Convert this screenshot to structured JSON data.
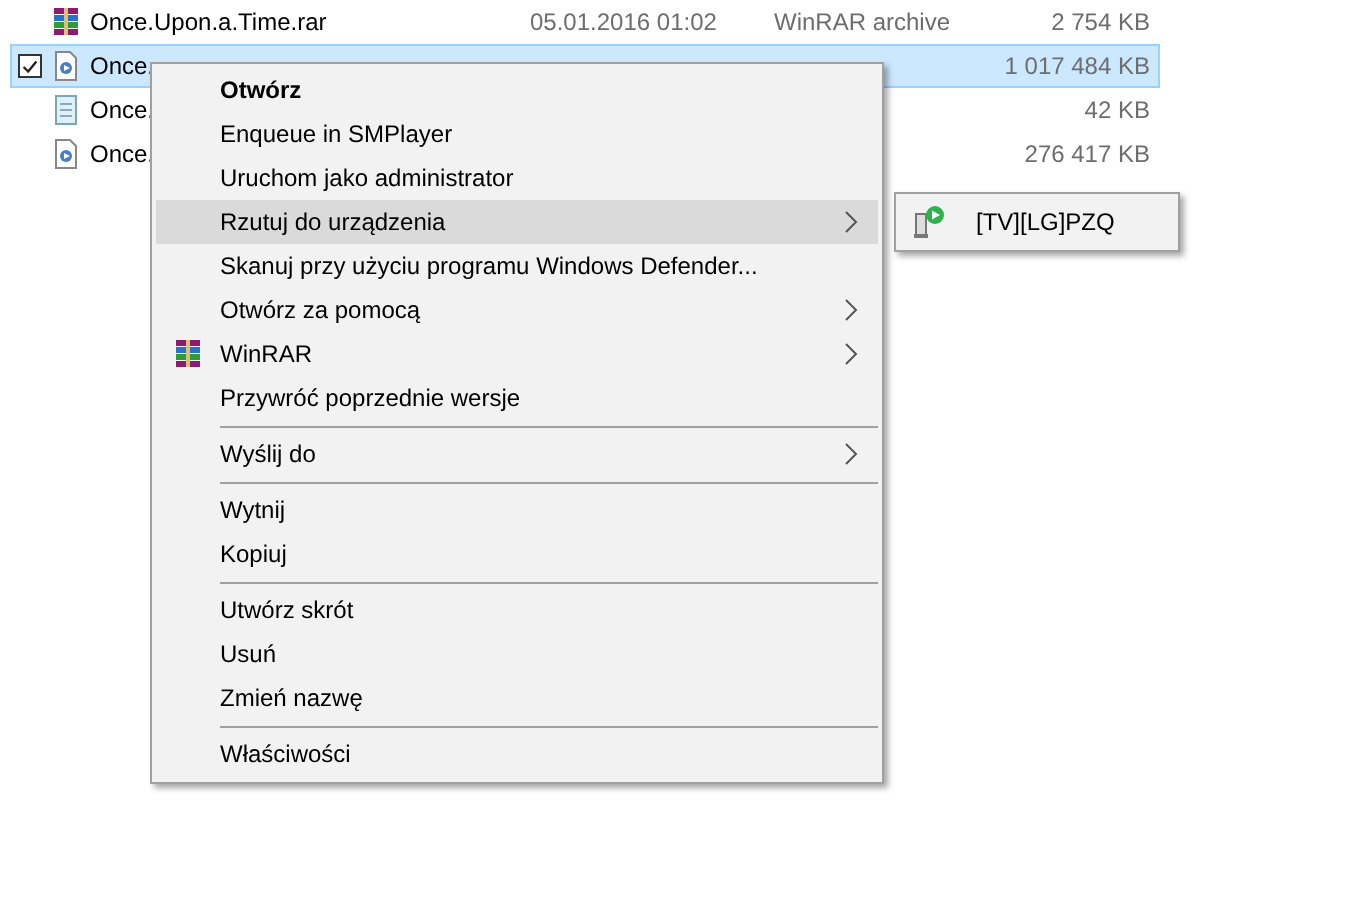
{
  "files": [
    {
      "kind": "archive",
      "checked": false,
      "selected": false,
      "name": "Once.Upon.a.Time.rar",
      "date": "05.01.2016 01:02",
      "type": "WinRAR archive",
      "size": "2 754 KB"
    },
    {
      "kind": "video",
      "checked": true,
      "selected": true,
      "name": "Once.",
      "size": "1 017 484 KB"
    },
    {
      "kind": "text",
      "checked": false,
      "selected": false,
      "name": "Once.",
      "size": "42 KB"
    },
    {
      "kind": "video",
      "checked": false,
      "selected": false,
      "name": "Once.",
      "size": "276 417 KB"
    }
  ],
  "context_menu": {
    "items": [
      {
        "kind": "item",
        "label": "Otwórz",
        "bold": true,
        "selected": false,
        "submenu": false
      },
      {
        "kind": "item",
        "label": "Enqueue in SMPlayer",
        "bold": false,
        "selected": false,
        "submenu": false
      },
      {
        "kind": "item",
        "label": "Uruchom jako administrator",
        "bold": false,
        "selected": false,
        "submenu": false
      },
      {
        "kind": "item",
        "label": "Rzutuj do urządzenia",
        "bold": false,
        "selected": true,
        "submenu": true
      },
      {
        "kind": "item",
        "label": "Skanuj przy użyciu programu Windows Defender...",
        "bold": false,
        "selected": false,
        "submenu": false
      },
      {
        "kind": "item",
        "label": "Otwórz za pomocą",
        "bold": false,
        "selected": false,
        "submenu": true
      },
      {
        "kind": "app",
        "label": "WinRAR",
        "bold": false,
        "selected": false,
        "submenu": true
      },
      {
        "kind": "item",
        "label": "Przywróć poprzednie wersje",
        "bold": false,
        "selected": false,
        "submenu": false
      },
      {
        "kind": "separator"
      },
      {
        "kind": "item",
        "label": "Wyślij do",
        "bold": false,
        "selected": false,
        "submenu": true
      },
      {
        "kind": "separator"
      },
      {
        "kind": "item",
        "label": "Wytnij",
        "bold": false,
        "selected": false,
        "submenu": false
      },
      {
        "kind": "item",
        "label": "Kopiuj",
        "bold": false,
        "selected": false,
        "submenu": false
      },
      {
        "kind": "separator"
      },
      {
        "kind": "item",
        "label": "Utwórz skrót",
        "bold": false,
        "selected": false,
        "submenu": false
      },
      {
        "kind": "item",
        "label": "Usuń",
        "bold": false,
        "selected": false,
        "submenu": false
      },
      {
        "kind": "item",
        "label": "Zmień nazwę",
        "bold": false,
        "selected": false,
        "submenu": false
      },
      {
        "kind": "separator"
      },
      {
        "kind": "item",
        "label": "Właściwości",
        "bold": false,
        "selected": false,
        "submenu": false
      }
    ]
  },
  "submenu": {
    "items": [
      {
        "label": "[TV][LG]PZQ"
      }
    ]
  }
}
